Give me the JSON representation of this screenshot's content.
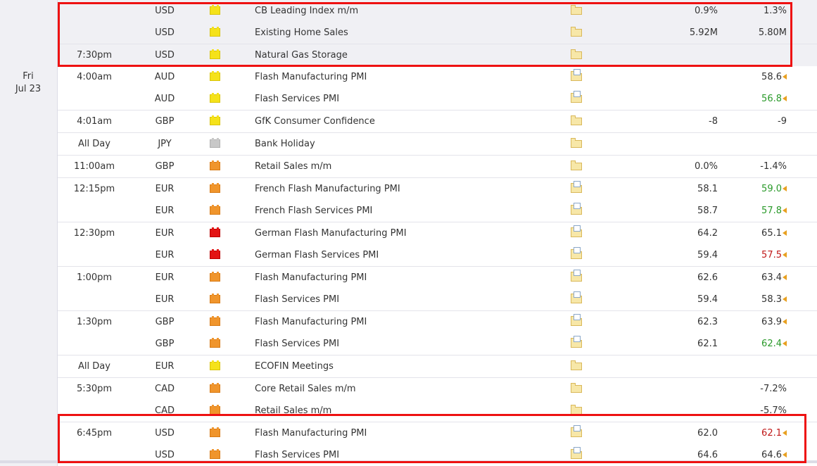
{
  "colors": {
    "highlight": "#ee1111",
    "green": "#2a9a2a",
    "red": "#c01818",
    "impact_yellow": "#f5e21a",
    "impact_orange": "#f0952c",
    "impact_red": "#e31414",
    "impact_gray": "#c8c8c8"
  },
  "prev_day": {
    "rows": [
      {
        "time": "",
        "currency": "USD",
        "impact": "yellow",
        "event": "CB Leading Index m/m",
        "detail_icon": "folder-icon",
        "forecast": "0.9%",
        "previous": "1.3%",
        "prev_class": "",
        "revised": false
      },
      {
        "time": "",
        "currency": "USD",
        "impact": "yellow",
        "event": "Existing Home Sales",
        "detail_icon": "folder-icon",
        "forecast": "5.92M",
        "previous": "5.80M",
        "prev_class": "",
        "revised": false
      },
      {
        "time": "7:30pm",
        "currency": "USD",
        "impact": "yellow",
        "event": "Natural Gas Storage",
        "detail_icon": "folder-icon",
        "forecast": "",
        "previous": "",
        "prev_class": "",
        "revised": false
      }
    ]
  },
  "day": {
    "weekday": "Fri",
    "date": "Jul 23",
    "rows": [
      {
        "time": "4:00am",
        "currency": "AUD",
        "impact": "yellow",
        "event": "Flash Manufacturing PMI",
        "detail_icon": "document-folder-icon",
        "forecast": "",
        "previous": "58.6",
        "prev_class": "",
        "revised": true
      },
      {
        "time": "",
        "currency": "AUD",
        "impact": "yellow",
        "event": "Flash Services PMI",
        "detail_icon": "document-folder-icon",
        "forecast": "",
        "previous": "56.8",
        "prev_class": "val-green",
        "revised": true
      },
      {
        "time": "4:01am",
        "currency": "GBP",
        "impact": "yellow",
        "event": "GfK Consumer Confidence",
        "detail_icon": "folder-icon",
        "forecast": "-8",
        "previous": "-9",
        "prev_class": "",
        "revised": false
      },
      {
        "time": "All Day",
        "currency": "JPY",
        "impact": "gray",
        "event": "Bank Holiday",
        "detail_icon": "folder-icon",
        "forecast": "",
        "previous": "",
        "prev_class": "",
        "revised": false
      },
      {
        "time": "11:00am",
        "currency": "GBP",
        "impact": "orange",
        "event": "Retail Sales m/m",
        "detail_icon": "folder-icon",
        "forecast": "0.0%",
        "previous": "-1.4%",
        "prev_class": "",
        "revised": false
      },
      {
        "time": "12:15pm",
        "currency": "EUR",
        "impact": "orange",
        "event": "French Flash Manufacturing PMI",
        "detail_icon": "document-folder-icon",
        "forecast": "58.1",
        "previous": "59.0",
        "prev_class": "val-green",
        "revised": true
      },
      {
        "time": "",
        "currency": "EUR",
        "impact": "orange",
        "event": "French Flash Services PMI",
        "detail_icon": "document-folder-icon",
        "forecast": "58.7",
        "previous": "57.8",
        "prev_class": "val-green",
        "revised": true
      },
      {
        "time": "12:30pm",
        "currency": "EUR",
        "impact": "red",
        "event": "German Flash Manufacturing PMI",
        "detail_icon": "document-folder-icon",
        "forecast": "64.2",
        "previous": "65.1",
        "prev_class": "",
        "revised": true
      },
      {
        "time": "",
        "currency": "EUR",
        "impact": "red",
        "event": "German Flash Services PMI",
        "detail_icon": "document-folder-icon",
        "forecast": "59.4",
        "previous": "57.5",
        "prev_class": "val-red",
        "revised": true
      },
      {
        "time": "1:00pm",
        "currency": "EUR",
        "impact": "orange",
        "event": "Flash Manufacturing PMI",
        "detail_icon": "document-folder-icon",
        "forecast": "62.6",
        "previous": "63.4",
        "prev_class": "",
        "revised": true
      },
      {
        "time": "",
        "currency": "EUR",
        "impact": "orange",
        "event": "Flash Services PMI",
        "detail_icon": "document-folder-icon",
        "forecast": "59.4",
        "previous": "58.3",
        "prev_class": "",
        "revised": true
      },
      {
        "time": "1:30pm",
        "currency": "GBP",
        "impact": "orange",
        "event": "Flash Manufacturing PMI",
        "detail_icon": "document-folder-icon",
        "forecast": "62.3",
        "previous": "63.9",
        "prev_class": "",
        "revised": true
      },
      {
        "time": "",
        "currency": "GBP",
        "impact": "orange",
        "event": "Flash Services PMI",
        "detail_icon": "document-folder-icon",
        "forecast": "62.1",
        "previous": "62.4",
        "prev_class": "val-green",
        "revised": true
      },
      {
        "time": "All Day",
        "currency": "EUR",
        "impact": "yellow",
        "event": "ECOFIN Meetings",
        "detail_icon": "folder-icon",
        "forecast": "",
        "previous": "",
        "prev_class": "",
        "revised": false
      },
      {
        "time": "5:30pm",
        "currency": "CAD",
        "impact": "orange",
        "event": "Core Retail Sales m/m",
        "detail_icon": "folder-icon",
        "forecast": "",
        "previous": "-7.2%",
        "prev_class": "",
        "revised": false
      },
      {
        "time": "",
        "currency": "CAD",
        "impact": "orange",
        "event": "Retail Sales m/m",
        "detail_icon": "folder-icon",
        "forecast": "",
        "previous": "-5.7%",
        "prev_class": "",
        "revised": false
      },
      {
        "time": "6:45pm",
        "currency": "USD",
        "impact": "orange",
        "event": "Flash Manufacturing PMI",
        "detail_icon": "document-folder-icon",
        "forecast": "62.0",
        "previous": "62.1",
        "prev_class": "val-red",
        "revised": true
      },
      {
        "time": "",
        "currency": "USD",
        "impact": "orange",
        "event": "Flash Services PMI",
        "detail_icon": "document-folder-icon",
        "forecast": "64.6",
        "previous": "64.6",
        "prev_class": "",
        "revised": true
      }
    ]
  }
}
